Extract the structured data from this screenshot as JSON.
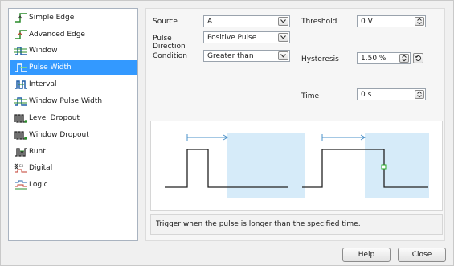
{
  "trigger_types": [
    {
      "label": "Simple Edge",
      "icon": "simple-edge-icon",
      "selected": false
    },
    {
      "label": "Advanced Edge",
      "icon": "advanced-edge-icon",
      "selected": false
    },
    {
      "label": "Window",
      "icon": "window-icon",
      "selected": false
    },
    {
      "label": "Pulse Width",
      "icon": "pulse-width-icon",
      "selected": true
    },
    {
      "label": "Interval",
      "icon": "interval-icon",
      "selected": false
    },
    {
      "label": "Window Pulse Width",
      "icon": "window-pulse-width-icon",
      "selected": false
    },
    {
      "label": "Level Dropout",
      "icon": "level-dropout-icon",
      "selected": false
    },
    {
      "label": "Window Dropout",
      "icon": "window-dropout-icon",
      "selected": false
    },
    {
      "label": "Runt",
      "icon": "runt-icon",
      "selected": false
    },
    {
      "label": "Digital",
      "icon": "digital-icon",
      "selected": false
    },
    {
      "label": "Logic",
      "icon": "logic-icon",
      "selected": false
    }
  ],
  "settings": {
    "source_label": "Source",
    "source_value": "A",
    "pulse_direction_label": "Pulse\nDirection",
    "pulse_direction_value": "Positive Pulse",
    "condition_label": "Condition",
    "condition_value": "Greater than",
    "threshold_label": "Threshold",
    "threshold_value": "0 V",
    "hysteresis_label": "Hysteresis",
    "hysteresis_value": "1.50 %",
    "time_label": "Time",
    "time_value": "0 s"
  },
  "description": "Trigger when the pulse is longer than the specified time.",
  "buttons": {
    "help": "Help",
    "close": "Close"
  },
  "colors": {
    "selection": "#3399ff",
    "shade": "#d6ebf9",
    "arrow": "#4a90c8",
    "trigger_point": "#22aa22"
  }
}
